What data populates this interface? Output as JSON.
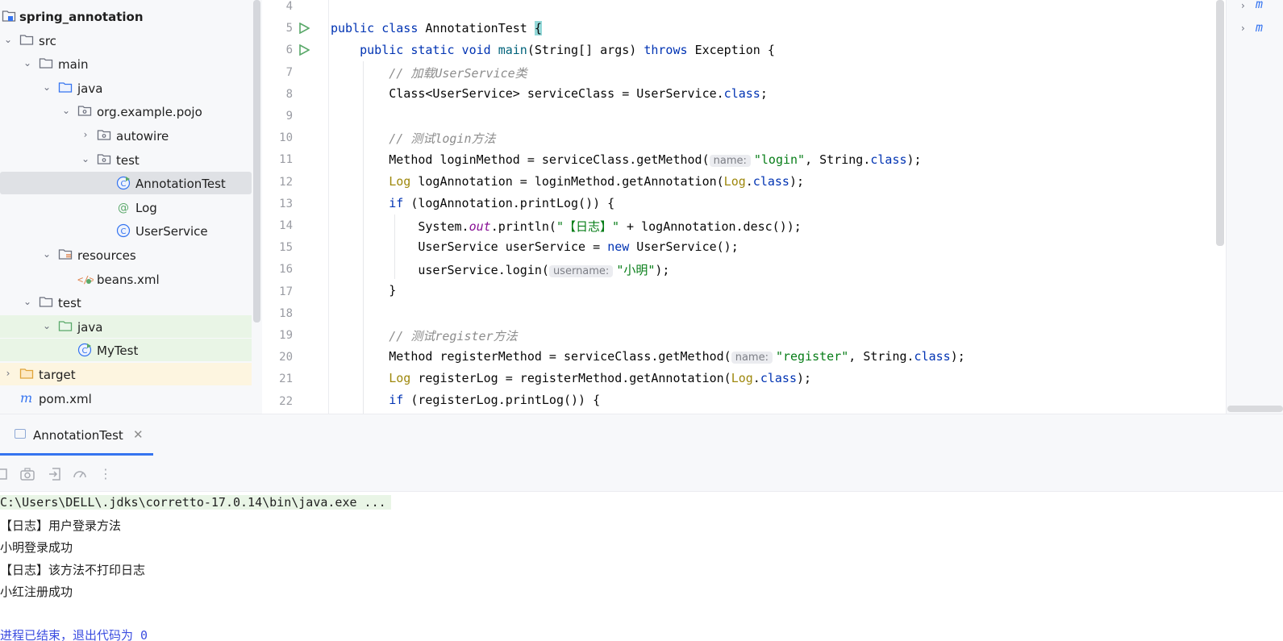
{
  "project": {
    "items": [
      {
        "name": "spring_annotation",
        "kind": "module",
        "depth": 0,
        "chevron": "",
        "bold": true
      },
      {
        "name": "src",
        "kind": "folder",
        "depth": 0,
        "chevron": "down"
      },
      {
        "name": "main",
        "kind": "folder",
        "depth": 1,
        "chevron": "down"
      },
      {
        "name": "java",
        "kind": "source-folder",
        "depth": 2,
        "chevron": "down"
      },
      {
        "name": "org.example.pojo",
        "kind": "package",
        "depth": 3,
        "chevron": "down"
      },
      {
        "name": "autowire",
        "kind": "package",
        "depth": 4,
        "chevron": "right"
      },
      {
        "name": "test",
        "kind": "package",
        "depth": 4,
        "chevron": "down"
      },
      {
        "name": "AnnotationTest",
        "kind": "class-main",
        "depth": 5,
        "chevron": "",
        "selected": true
      },
      {
        "name": "Log",
        "kind": "annotation",
        "depth": 5,
        "chevron": ""
      },
      {
        "name": "UserService",
        "kind": "class",
        "depth": 5,
        "chevron": ""
      },
      {
        "name": "resources",
        "kind": "resources-folder",
        "depth": 2,
        "chevron": "down"
      },
      {
        "name": "beans.xml",
        "kind": "xml",
        "depth": 3,
        "chevron": ""
      },
      {
        "name": "test",
        "kind": "folder",
        "depth": 1,
        "chevron": "down"
      },
      {
        "name": "java",
        "kind": "test-folder",
        "depth": 2,
        "chevron": "down",
        "highlight": "green"
      },
      {
        "name": "MyTest",
        "kind": "class-main",
        "depth": 3,
        "chevron": "",
        "highlight": "green"
      },
      {
        "name": "target",
        "kind": "excluded-folder",
        "depth": 0,
        "chevron": "right",
        "highlight": "yellow"
      },
      {
        "name": "pom.xml",
        "kind": "maven",
        "depth": 0,
        "chevron": ""
      }
    ]
  },
  "editor": {
    "line_numbers": [
      "4",
      "5",
      "6",
      "7",
      "8",
      "9",
      "10",
      "11",
      "12",
      "13",
      "14",
      "15",
      "16",
      "17",
      "18",
      "19",
      "20",
      "21",
      "22"
    ],
    "code": {
      "l5_public": "public",
      "l5_class": "class",
      "l5_name": "AnnotationTest",
      "l5_brace": "{",
      "l6_mods": "public static void",
      "l6_main": "main",
      "l6_params": "(String[] args)",
      "l6_throws": "throws",
      "l6_rest": "Exception {",
      "l7_comment": "// 加载UserService类",
      "l8_a": "Class<UserService> serviceClass = UserService.",
      "l8_class": "class",
      "l8_end": ";",
      "l10_comment": "// 测试login方法",
      "l11_a": "Method loginMethod = serviceClass.getMethod(",
      "l11_hint": "name:",
      "l11_str": "\"login\"",
      "l11_b": ", String.",
      "l11_class": "class",
      "l11_end": ");",
      "l12_log": "Log",
      "l12_a": " logAnnotation = loginMethod.getAnnotation(",
      "l12_log2": "Log",
      "l12_dot": ".",
      "l12_class": "class",
      "l12_end": ");",
      "l13_if": "if",
      "l13_rest": " (logAnnotation.printLog()) {",
      "l14_a": "System.",
      "l14_out": "out",
      "l14_b": ".println(",
      "l14_str": "\"【日志】\"",
      "l14_c": " + logAnnotation.desc());",
      "l15_a": "UserService userService = ",
      "l15_new": "new",
      "l15_b": " UserService();",
      "l16_a": "userService.login(",
      "l16_hint": "username:",
      "l16_str": "\"小明\"",
      "l16_end": ");",
      "l17": "}",
      "l19_comment": "// 测试register方法",
      "l20_a": "Method registerMethod = serviceClass.getMethod(",
      "l20_hint": "name:",
      "l20_str": "\"register\"",
      "l20_b": ", String.",
      "l20_class": "class",
      "l20_end": ");",
      "l21_log": "Log",
      "l21_a": " registerLog = registerMethod.getAnnotation(",
      "l21_log2": "Log",
      "l21_dot": ".",
      "l21_class": "class",
      "l21_end": ");",
      "l22_if": "if",
      "l22_rest": " (registerLog.printLog()) {"
    }
  },
  "run": {
    "tab_label": "AnnotationTest",
    "close_glyph": "✕",
    "console_lines": [
      {
        "text": "C:\\Users\\DELL\\.jdks\\corretto-17.0.14\\bin\\java.exe ...",
        "type": "cmd"
      },
      {
        "text": "【日志】用户登录方法",
        "type": "out"
      },
      {
        "text": "小明登录成功",
        "type": "out"
      },
      {
        "text": "【日志】该方法不打印日志",
        "type": "out"
      },
      {
        "text": "小红注册成功",
        "type": "out"
      },
      {
        "text": "",
        "type": "out"
      },
      {
        "text": "进程已结束，退出代码为 0",
        "type": "exit"
      }
    ]
  },
  "colors": {
    "keyword": "#0033b3",
    "string": "#067d17",
    "comment": "#8c8c8c",
    "annotation": "#9e880d",
    "accent": "#3574f0",
    "run_green": "#59a869",
    "selected_bg": "#dfe1e5",
    "test_bg": "#e9f5e6",
    "excluded_bg": "#fdf5e0"
  }
}
